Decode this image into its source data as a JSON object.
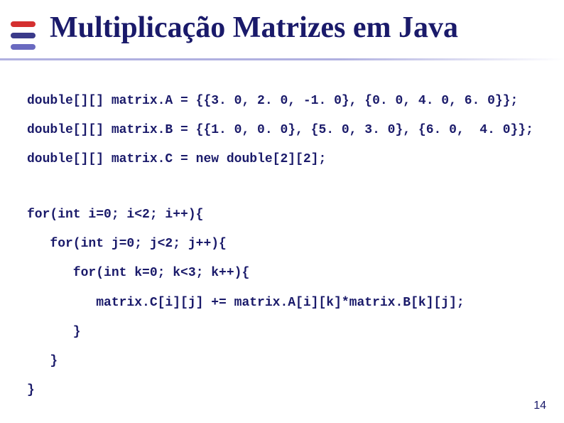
{
  "title": "Multiplicação Matrizes em Java",
  "code": {
    "line1": "double[][] matrix.A = {{3. 0, 2. 0, -1. 0}, {0. 0, 4. 0, 6. 0}};",
    "line2": "double[][] matrix.B = {{1. 0, 0. 0}, {5. 0, 3. 0}, {6. 0,  4. 0}};",
    "line3": "double[][] matrix.C = new double[2][2];",
    "line4": "for(int i=0; i<2; i++){",
    "line5": "   for(int j=0; j<2; j++){",
    "line6": "      for(int k=0; k<3; k++){",
    "line7": "         matrix.C[i][j] += matrix.A[i][k]*matrix.B[k][j];",
    "line8": "      }",
    "line9": "   }",
    "line10": "}"
  },
  "pageNumber": "14"
}
